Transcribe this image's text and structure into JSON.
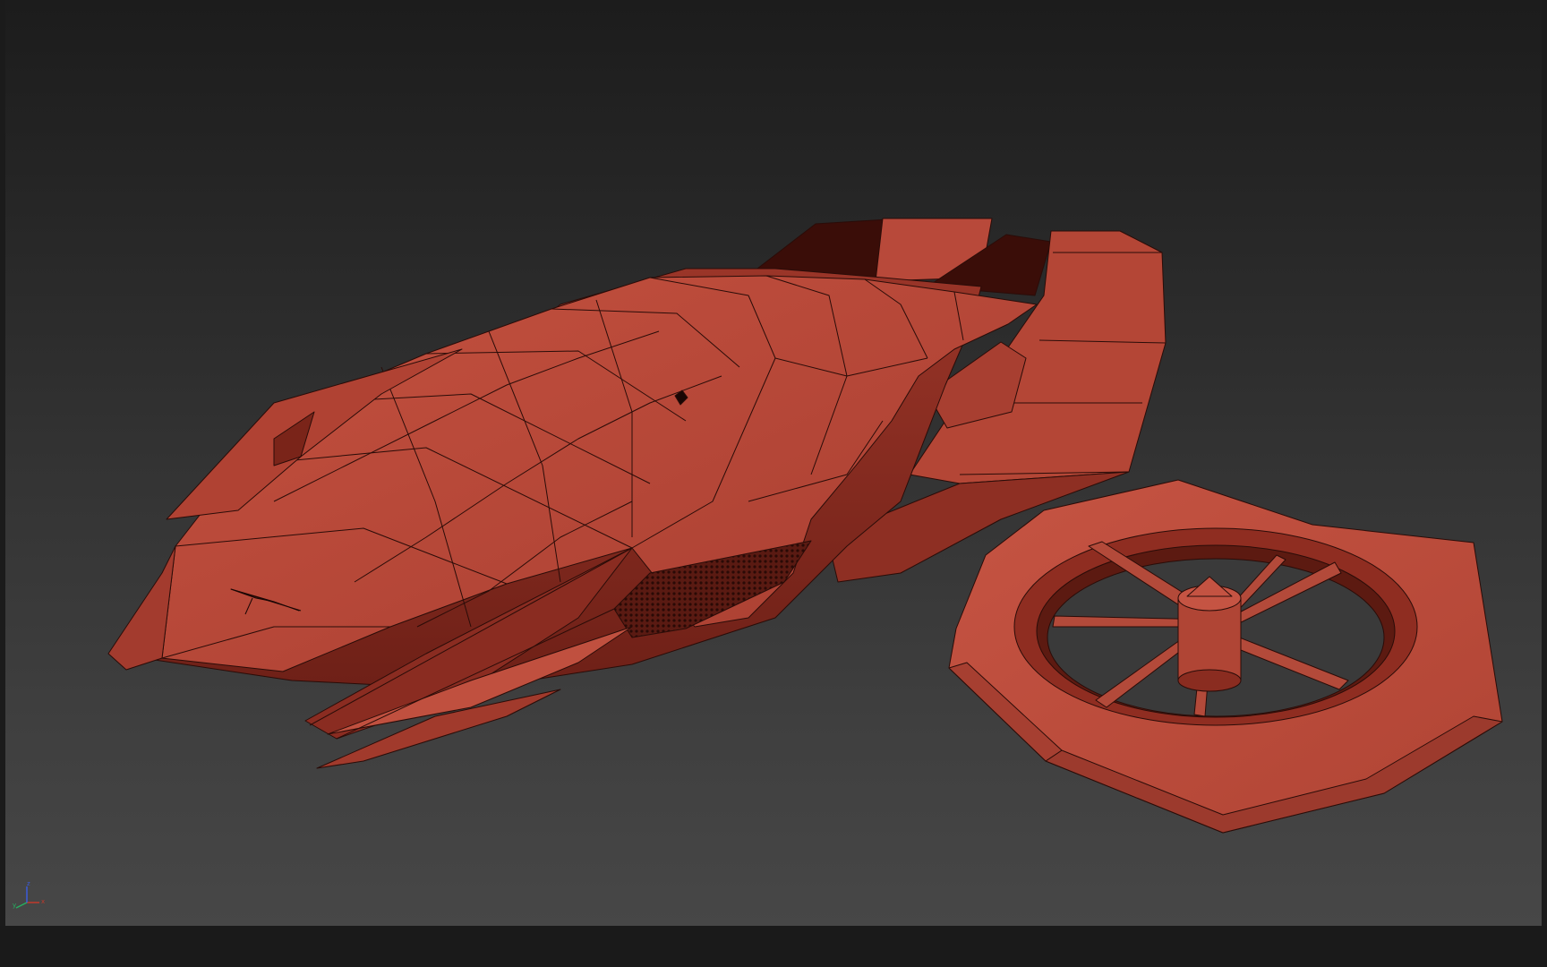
{
  "viewport": {
    "background_top": "#1c1c1c",
    "background_bottom": "#474747",
    "model_color": "#b84a3c",
    "wire_color": "#2a0c08"
  },
  "gizmo": {
    "x_label": "x",
    "y_label": "y",
    "z_label": "z",
    "x_color": "#c0392b",
    "y_color": "#27ae60",
    "z_color": "#3b5bdb"
  }
}
